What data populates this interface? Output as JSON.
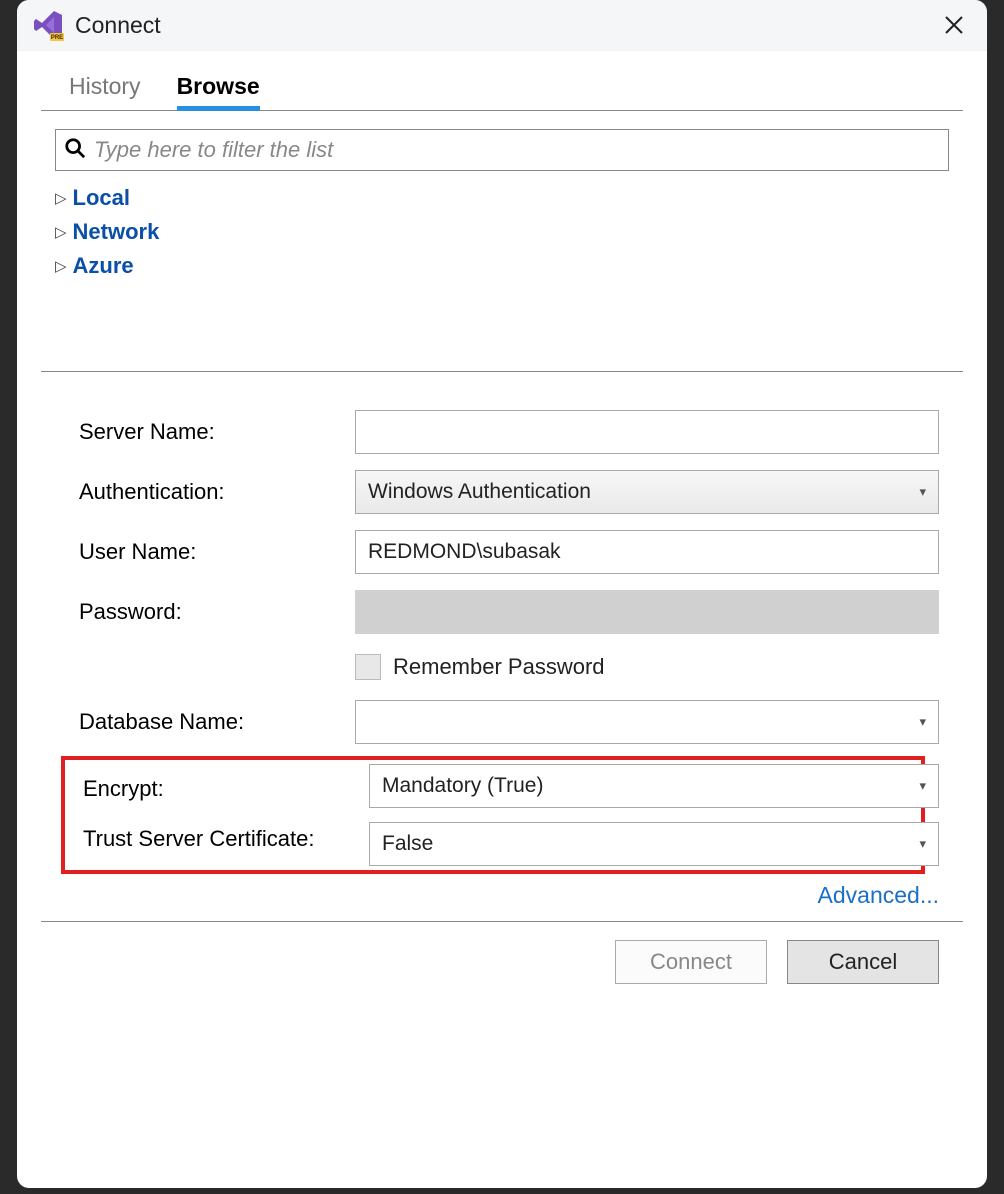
{
  "titlebar": {
    "title": "Connect"
  },
  "tabs": {
    "history": "History",
    "browse": "Browse",
    "active": "browse"
  },
  "filter": {
    "placeholder": "Type here to filter the list"
  },
  "tree": {
    "items": [
      {
        "label": "Local"
      },
      {
        "label": "Network"
      },
      {
        "label": "Azure"
      }
    ]
  },
  "form": {
    "serverName": {
      "label": "Server Name:",
      "value": ""
    },
    "authentication": {
      "label": "Authentication:",
      "value": "Windows Authentication"
    },
    "userName": {
      "label": "User Name:",
      "value": "REDMOND\\subasak"
    },
    "password": {
      "label": "Password:",
      "value": ""
    },
    "rememberPassword": {
      "label": "Remember Password",
      "checked": false
    },
    "databaseName": {
      "label": "Database Name:",
      "value": ""
    },
    "encrypt": {
      "label": "Encrypt:",
      "value": "Mandatory (True)"
    },
    "trustServerCertificate": {
      "label": "Trust Server Certificate:",
      "value": "False"
    },
    "advancedLink": "Advanced..."
  },
  "footer": {
    "connect": "Connect",
    "cancel": "Cancel"
  }
}
